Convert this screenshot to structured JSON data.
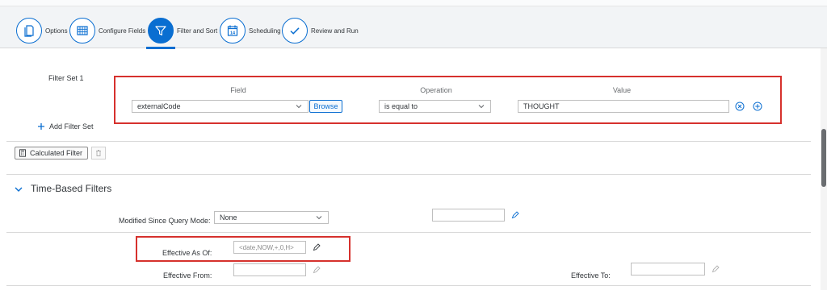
{
  "wizard": {
    "steps": [
      {
        "label": "Options",
        "icon": "document-icon"
      },
      {
        "label": "Configure Fields",
        "icon": "table-grid-icon"
      },
      {
        "label": "Filter and Sort",
        "icon": "filter-icon"
      },
      {
        "label": "Scheduling",
        "icon": "calendar-icon",
        "icon_text": "14"
      },
      {
        "label": "Review and Run",
        "icon": "checkmark-icon"
      }
    ],
    "active_step": "Filter and Sort"
  },
  "filter": {
    "set_label": "Filter Set 1",
    "headers": {
      "field": "Field",
      "operation": "Operation",
      "value": "Value"
    },
    "field_value": "externalCode",
    "browse_label": "Browse",
    "operation_value": "is equal to",
    "value": "THOUGHT",
    "add_filter_set_label": "Add Filter Set",
    "calculated_filter_label": "Calculated Filter"
  },
  "time_based": {
    "title": "Time-Based Filters",
    "modified_since_label": "Modified Since Query Mode:",
    "modified_since_value": "None",
    "effective_as_of_label": "Effective As Of:",
    "effective_as_of_placeholder": "<date,NOW,+,0,H>",
    "effective_from_label": "Effective From:",
    "effective_to_label": "Effective To:"
  },
  "colors": {
    "accent": "#0a6ed1",
    "highlight_box": "#d6312d"
  }
}
